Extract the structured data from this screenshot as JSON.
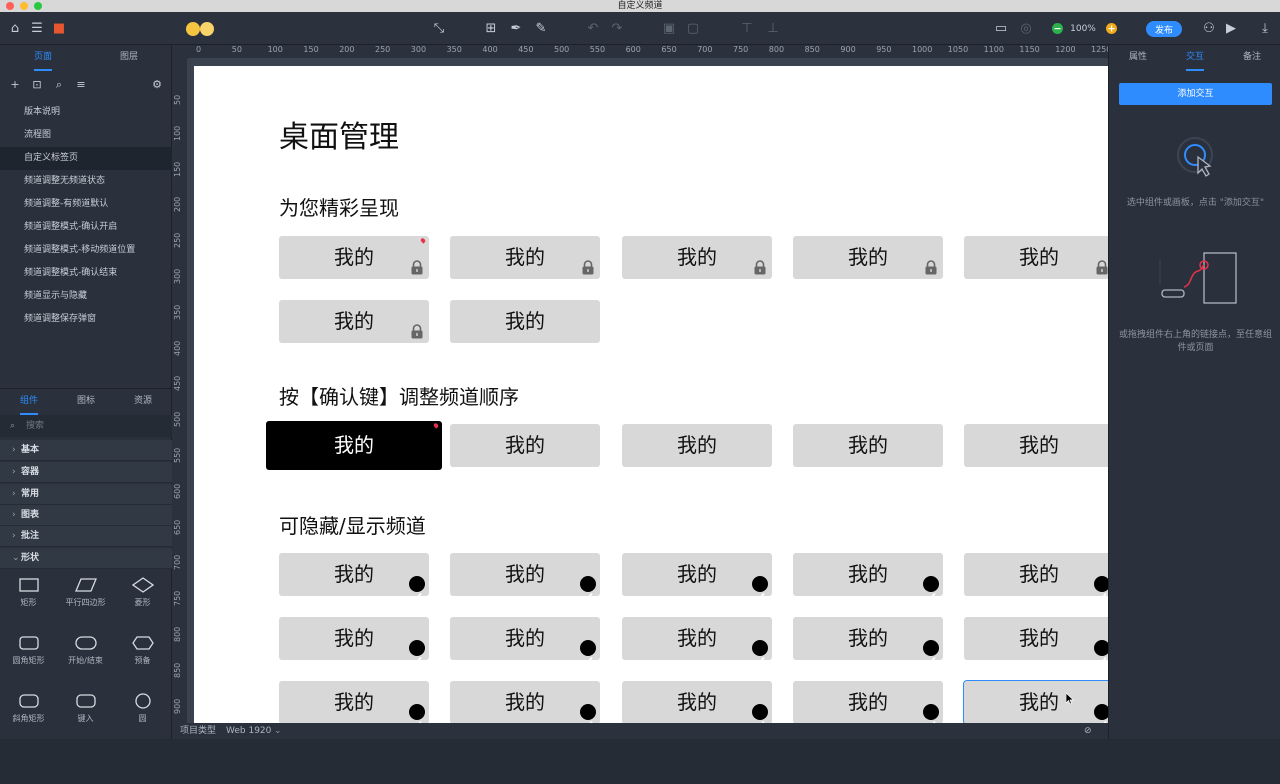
{
  "window": {
    "title": "自定义频道"
  },
  "toolbar": {
    "zoom": "100%",
    "publish_label": "发布"
  },
  "left_panel": {
    "tabs": [
      "页面",
      "图层"
    ],
    "pages": [
      "版本说明",
      "流程图",
      "自定义标签页",
      "频道调整无频道状态",
      "频道调整-有频道默认",
      "频道调整模式-确认开启",
      "频道调整模式-移动频道位置",
      "频道调整模式-确认结束",
      "频道显示与隐藏",
      "频道调整保存弹窗"
    ],
    "component_tabs": [
      "组件",
      "图标",
      "资源"
    ],
    "search_placeholder": "搜索",
    "categories": [
      "基本",
      "容器",
      "常用",
      "图表",
      "批注",
      "形状"
    ],
    "shapes": [
      "矩形",
      "平行四边形",
      "菱形",
      "圆角矩形",
      "开始/结束",
      "预备",
      "斜角矩形",
      "键入",
      "圆"
    ]
  },
  "ruler": {
    "top": [
      "0",
      "50",
      "100",
      "150",
      "200",
      "250",
      "300",
      "350",
      "400",
      "450",
      "500",
      "550",
      "600",
      "650",
      "700",
      "750",
      "800",
      "850",
      "900",
      "950",
      "1000",
      "1050",
      "1100",
      "1150",
      "1200",
      "1250"
    ],
    "left": [
      "50",
      "100",
      "150",
      "200",
      "250",
      "300",
      "350",
      "400",
      "450",
      "500",
      "550",
      "600",
      "650",
      "700",
      "750",
      "800",
      "850",
      "900"
    ]
  },
  "canvas": {
    "title": "桌面管理",
    "section1": "为您精彩呈现",
    "section2": "按【确认键】调整频道顺序",
    "section3": "可隐藏/显示频道",
    "card_label": "我的"
  },
  "right_panel": {
    "tabs": [
      "属性",
      "交互",
      "备注"
    ],
    "add_button": "添加交互",
    "hint1": "选中组件或画板，点击 \"添加交互\"",
    "hint2": "或拖拽组件右上角的链接点，至任意组件或页面"
  },
  "status_bar": {
    "project_type_label": "项目类型",
    "project_type_value": "Web 1920"
  }
}
